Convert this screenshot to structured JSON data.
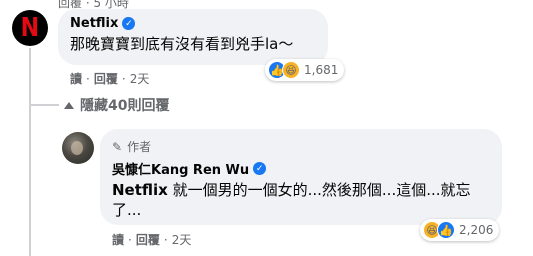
{
  "top_partial": {
    "reply": "回覆",
    "time": "5 小時"
  },
  "comment1": {
    "author": "Netflix",
    "text": "那晚寶寶到底有沒有看到兇手la～",
    "actions": {
      "read": "讀",
      "reply": "回覆",
      "time": "2天"
    },
    "reactions": {
      "icons": [
        "like-icon",
        "haha-icon"
      ],
      "count": "1,681"
    }
  },
  "hidden_replies": {
    "label": "隱藏40則回覆"
  },
  "comment2": {
    "badge": "作者",
    "author": "吳慷仁Kang Ren Wu",
    "mention": "Netflix",
    "text_line1": " 就一個男的一個女的...然後那個...這個...就忘",
    "text_line2": "了...",
    "actions": {
      "read": "讀",
      "reply": "回覆",
      "time": "2天"
    },
    "reactions": {
      "icons": [
        "haha-icon",
        "like-icon"
      ],
      "count": "2,206"
    }
  },
  "colors": {
    "bubble": "#f0f2f5",
    "link_blue": "#1877f2",
    "netflix_red": "#e50914",
    "muted": "#65676b"
  }
}
